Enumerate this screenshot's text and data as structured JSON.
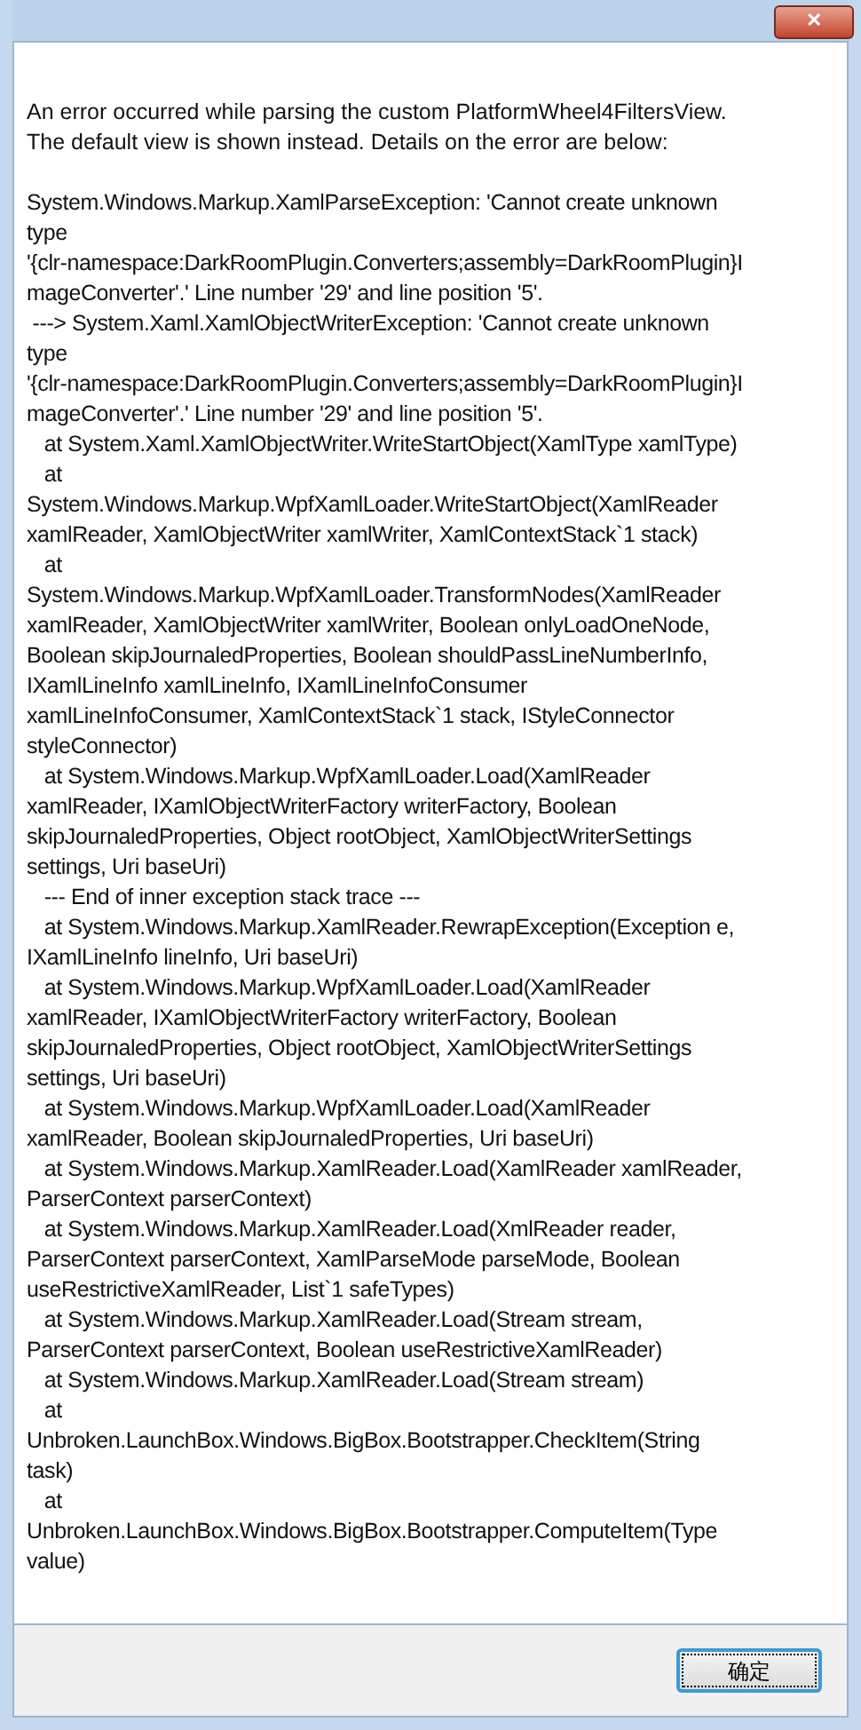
{
  "window": {
    "close_label": "✕"
  },
  "message": {
    "intro": "An error occurred while parsing the custom PlatformWheel4FiltersView.\nThe default view is shown instead. Details on the error are below:",
    "details": "System.Windows.Markup.XamlParseException: 'Cannot create unknown\ntype\n'{clr-namespace:DarkRoomPlugin.Converters;assembly=DarkRoomPlugin}I\nmageConverter'.' Line number '29' and line position '5'.\n ---> System.Xaml.XamlObjectWriterException: 'Cannot create unknown\ntype\n'{clr-namespace:DarkRoomPlugin.Converters;assembly=DarkRoomPlugin}I\nmageConverter'.' Line number '29' and line position '5'.\n   at System.Xaml.XamlObjectWriter.WriteStartObject(XamlType xamlType)\n   at\nSystem.Windows.Markup.WpfXamlLoader.WriteStartObject(XamlReader\nxamlReader, XamlObjectWriter xamlWriter, XamlContextStack`1 stack)\n   at\nSystem.Windows.Markup.WpfXamlLoader.TransformNodes(XamlReader\nxamlReader, XamlObjectWriter xamlWriter, Boolean onlyLoadOneNode,\nBoolean skipJournaledProperties, Boolean shouldPassLineNumberInfo,\nIXamlLineInfo xamlLineInfo, IXamlLineInfoConsumer\nxamlLineInfoConsumer, XamlContextStack`1 stack, IStyleConnector\nstyleConnector)\n   at System.Windows.Markup.WpfXamlLoader.Load(XamlReader\nxamlReader, IXamlObjectWriterFactory writerFactory, Boolean\nskipJournaledProperties, Object rootObject, XamlObjectWriterSettings\nsettings, Uri baseUri)\n   --- End of inner exception stack trace ---\n   at System.Windows.Markup.XamlReader.RewrapException(Exception e,\nIXamlLineInfo lineInfo, Uri baseUri)\n   at System.Windows.Markup.WpfXamlLoader.Load(XamlReader\nxamlReader, IXamlObjectWriterFactory writerFactory, Boolean\nskipJournaledProperties, Object rootObject, XamlObjectWriterSettings\nsettings, Uri baseUri)\n   at System.Windows.Markup.WpfXamlLoader.Load(XamlReader\nxamlReader, Boolean skipJournaledProperties, Uri baseUri)\n   at System.Windows.Markup.XamlReader.Load(XamlReader xamlReader,\nParserContext parserContext)\n   at System.Windows.Markup.XamlReader.Load(XmlReader reader,\nParserContext parserContext, XamlParseMode parseMode, Boolean\nuseRestrictiveXamlReader, List`1 safeTypes)\n   at System.Windows.Markup.XamlReader.Load(Stream stream,\nParserContext parserContext, Boolean useRestrictiveXamlReader)\n   at System.Windows.Markup.XamlReader.Load(Stream stream)\n   at\nUnbroken.LaunchBox.Windows.BigBox.Bootstrapper.CheckItem(String\ntask)\n   at\nUnbroken.LaunchBox.Windows.BigBox.Bootstrapper.ComputeItem(Type\nvalue)"
  },
  "buttons": [
    {
      "label": "确定",
      "focused": true
    }
  ]
}
